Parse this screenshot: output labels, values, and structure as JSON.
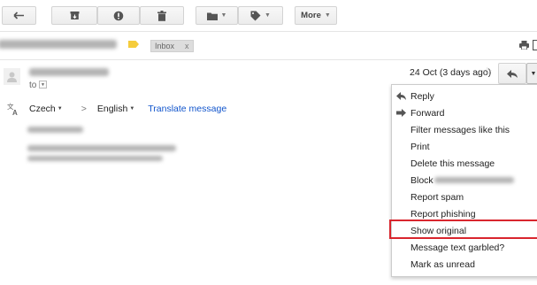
{
  "toolbar": {
    "more_label": "More"
  },
  "thread": {
    "label": "Inbox",
    "label_remove": "x"
  },
  "message": {
    "to_label": "to",
    "date": "24 Oct (3 days ago)",
    "star": "☆"
  },
  "translate": {
    "source_lang": "Czech",
    "arrow": ">",
    "target_lang": "English",
    "link": "Translate message"
  },
  "menu": {
    "items": [
      {
        "label": "Reply",
        "icon": "reply-icon"
      },
      {
        "label": "Forward",
        "icon": "forward-icon"
      },
      {
        "label": "Filter messages like this"
      },
      {
        "label": "Print"
      },
      {
        "label": "Delete this message"
      },
      {
        "label": "Block"
      },
      {
        "label": "Report spam"
      },
      {
        "label": "Report phishing"
      },
      {
        "label": "Show original"
      },
      {
        "label": "Message text garbled?"
      },
      {
        "label": "Mark as unread"
      }
    ]
  },
  "colors": {
    "highlight": "#d9262e",
    "link": "#1155cc",
    "label_marker": "#f5cc3c"
  }
}
